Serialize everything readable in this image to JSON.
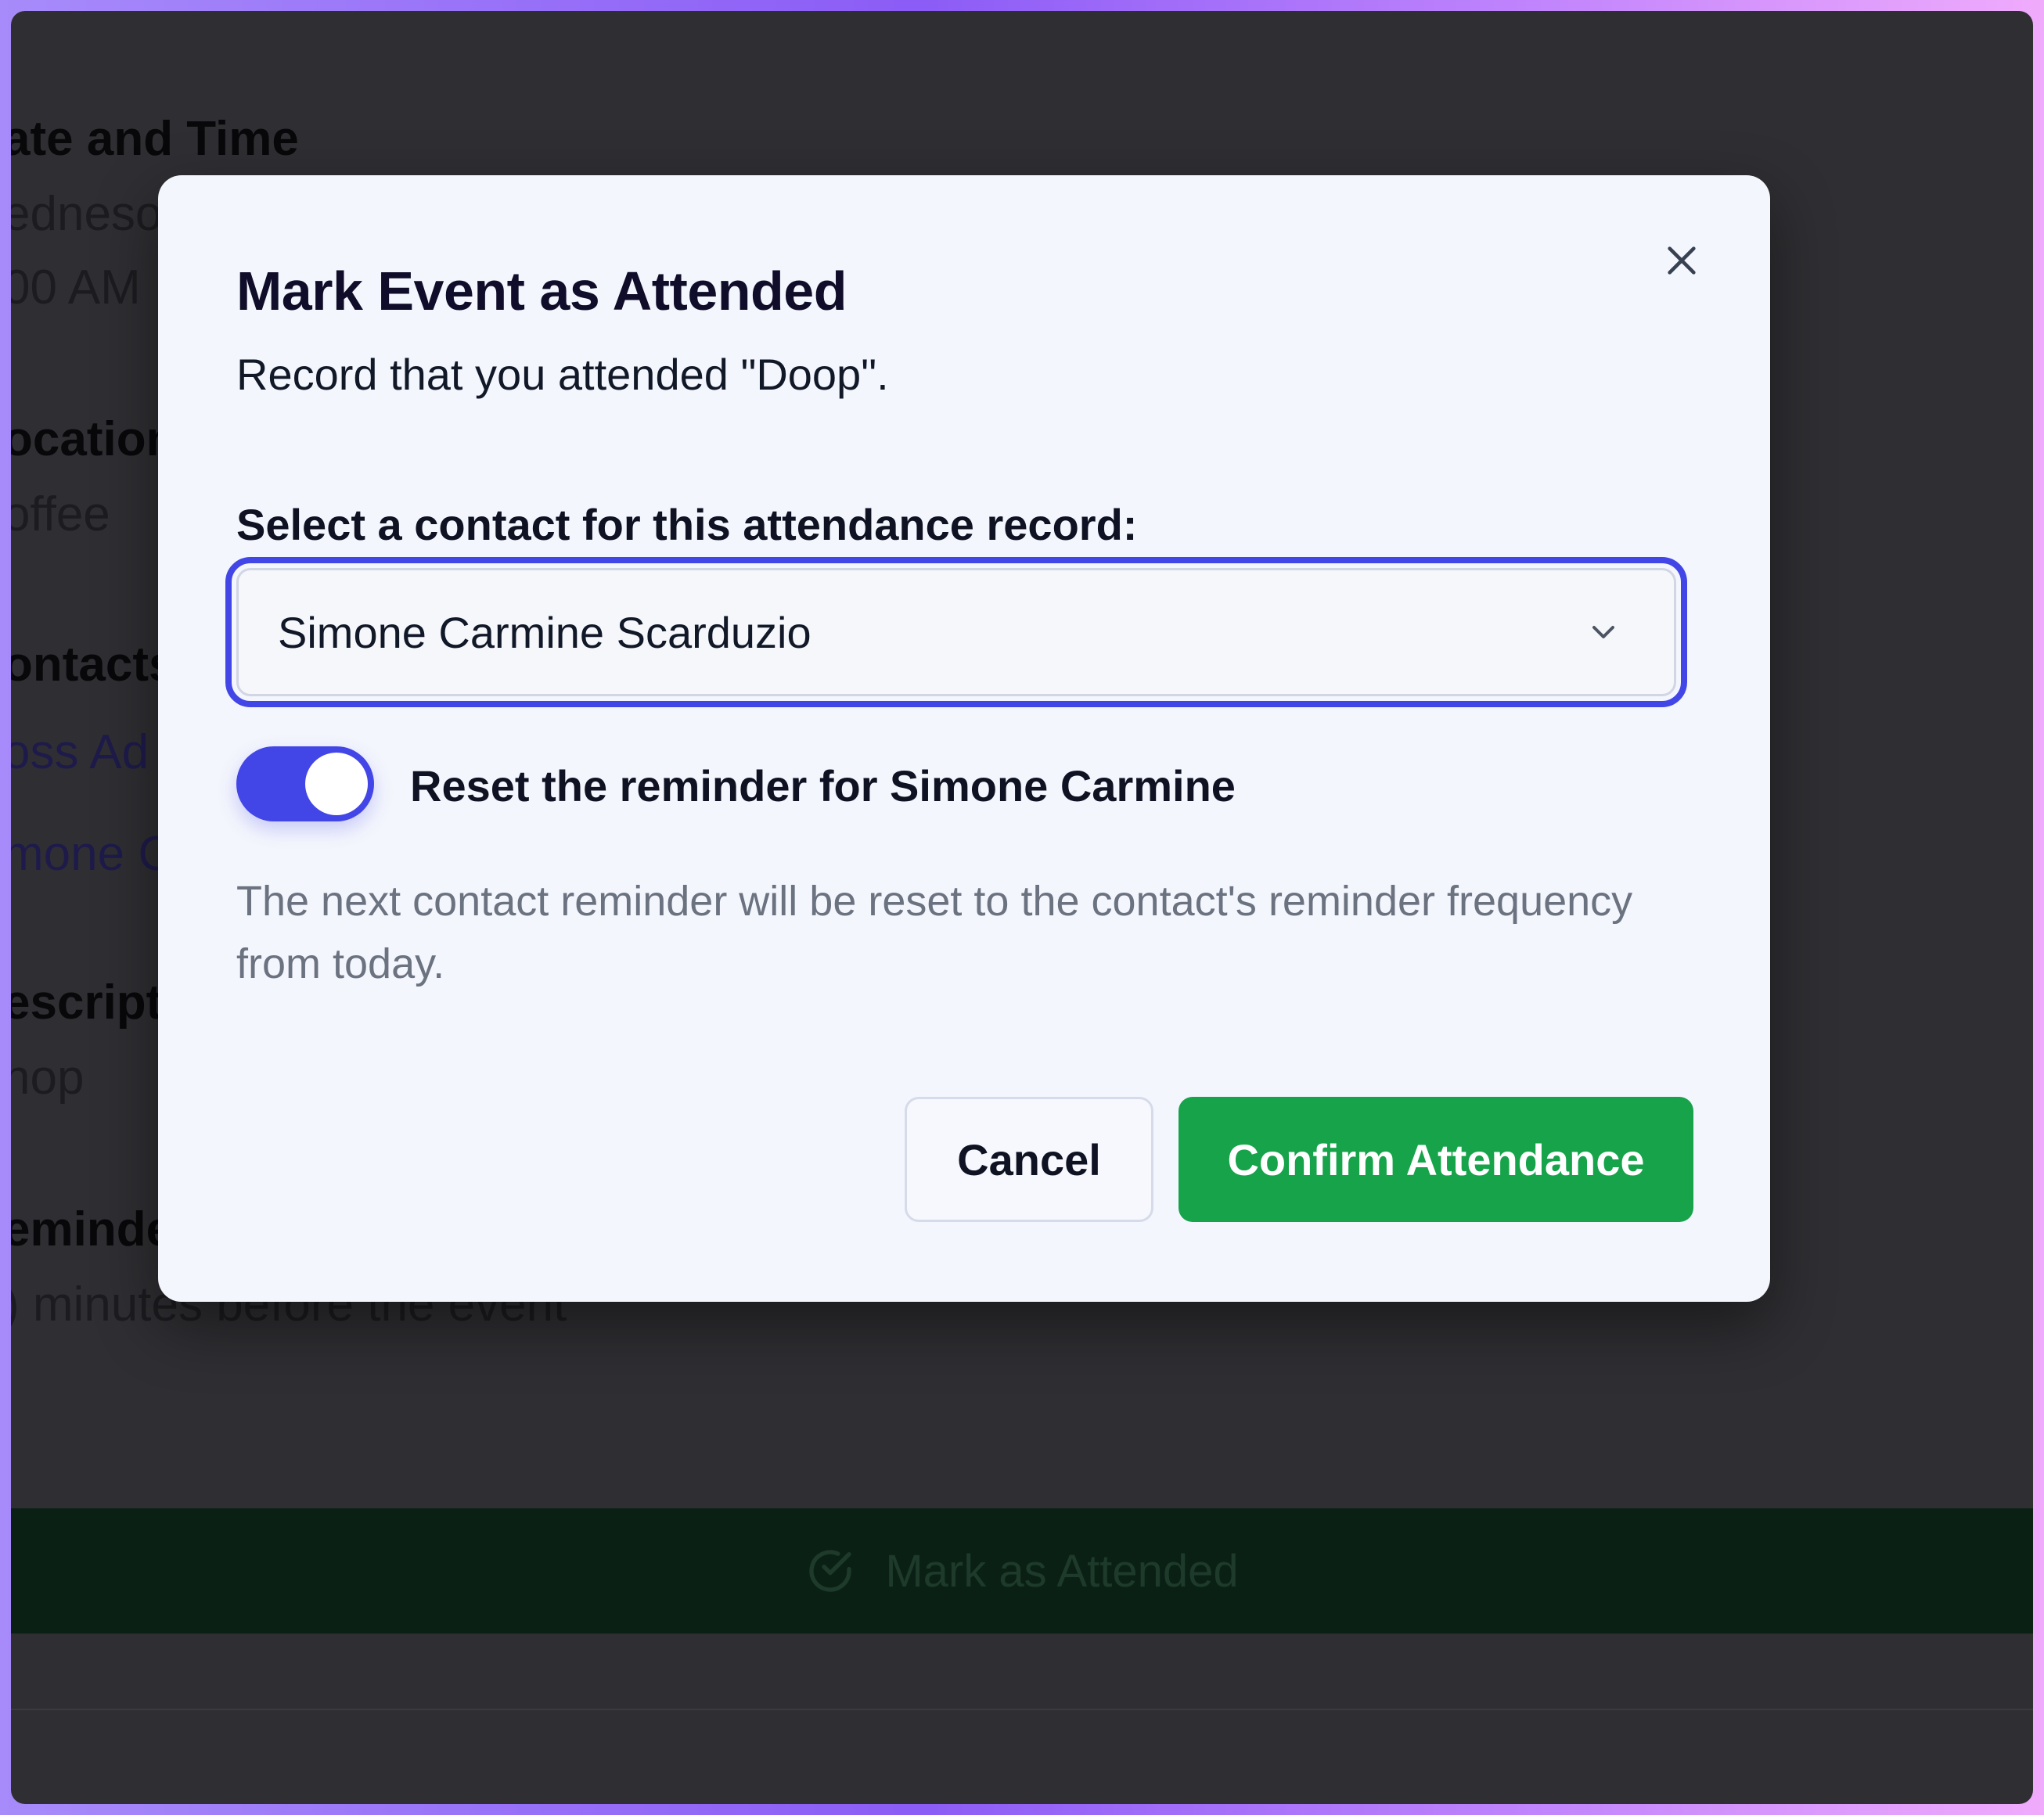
{
  "background": {
    "fields": [
      {
        "label": "ate and Time",
        "values": [
          "edneso",
          "00 AM"
        ]
      },
      {
        "label": "ocation",
        "values": [
          "offee"
        ]
      },
      {
        "label": "ontacts",
        "values": [
          "oss Ad",
          "mone C"
        ]
      },
      {
        "label": "escript",
        "values": [
          "nop"
        ]
      },
      {
        "label": "eminde",
        "values": [
          ") minutes before the event"
        ]
      }
    ],
    "attend_button_label": "Mark as Attended"
  },
  "modal": {
    "title": "Mark Event as Attended",
    "subtitle": "Record that you attended \"Doop\".",
    "contact_select": {
      "label": "Select a contact for this attendance record:",
      "selected_value": "Simone Carmine Scarduzio"
    },
    "reset_toggle": {
      "enabled": true,
      "label": "Reset the reminder for Simone Carmine"
    },
    "help_text": "The next contact reminder will be reset to the contact's reminder frequency from today.",
    "cancel_label": "Cancel",
    "confirm_label": "Confirm Attendance"
  },
  "colors": {
    "accent": "#4346e6",
    "confirm": "#16a34a",
    "overlay": "#2f2f33"
  }
}
